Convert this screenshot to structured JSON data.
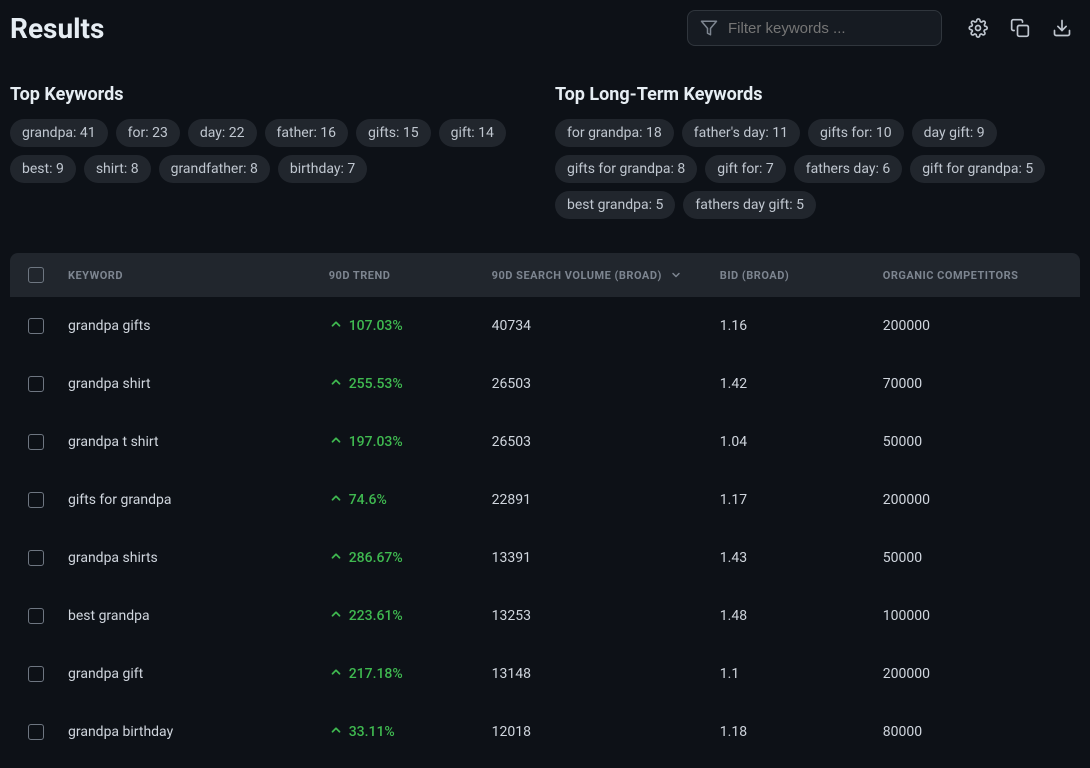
{
  "header": {
    "title": "Results",
    "search_placeholder": "Filter keywords ..."
  },
  "top_keywords": {
    "title": "Top Keywords",
    "pills": [
      "grandpa: 41",
      "for: 23",
      "day: 22",
      "father: 16",
      "gifts: 15",
      "gift: 14",
      "best: 9",
      "shirt: 8",
      "grandfather: 8",
      "birthday: 7"
    ]
  },
  "top_longterm": {
    "title": "Top Long-Term Keywords",
    "pills": [
      "for grandpa: 18",
      "father's day: 11",
      "gifts for: 10",
      "day gift: 9",
      "gifts for grandpa: 8",
      "gift for: 7",
      "fathers day: 6",
      "gift for grandpa: 5",
      "best grandpa: 5",
      "fathers day gift: 5"
    ]
  },
  "table": {
    "columns": {
      "keyword": "KEYWORD",
      "trend": "90D TREND",
      "volume": "90D SEARCH VOLUME (BROAD)",
      "bid": "BID (BROAD)",
      "organic": "ORGANIC COMPETITORS"
    },
    "rows": [
      {
        "keyword": "grandpa gifts",
        "trend": "107.03%",
        "volume": "40734",
        "bid": "1.16",
        "organic": "200000"
      },
      {
        "keyword": "grandpa shirt",
        "trend": "255.53%",
        "volume": "26503",
        "bid": "1.42",
        "organic": "70000"
      },
      {
        "keyword": "grandpa t shirt",
        "trend": "197.03%",
        "volume": "26503",
        "bid": "1.04",
        "organic": "50000"
      },
      {
        "keyword": "gifts for grandpa",
        "trend": "74.6%",
        "volume": "22891",
        "bid": "1.17",
        "organic": "200000"
      },
      {
        "keyword": "grandpa shirts",
        "trend": "286.67%",
        "volume": "13391",
        "bid": "1.43",
        "organic": "50000"
      },
      {
        "keyword": "best grandpa",
        "trend": "223.61%",
        "volume": "13253",
        "bid": "1.48",
        "organic": "100000"
      },
      {
        "keyword": "grandpa gift",
        "trend": "217.18%",
        "volume": "13148",
        "bid": "1.1",
        "organic": "200000"
      },
      {
        "keyword": "grandpa birthday",
        "trend": "33.11%",
        "volume": "12018",
        "bid": "1.18",
        "organic": "80000"
      }
    ]
  }
}
